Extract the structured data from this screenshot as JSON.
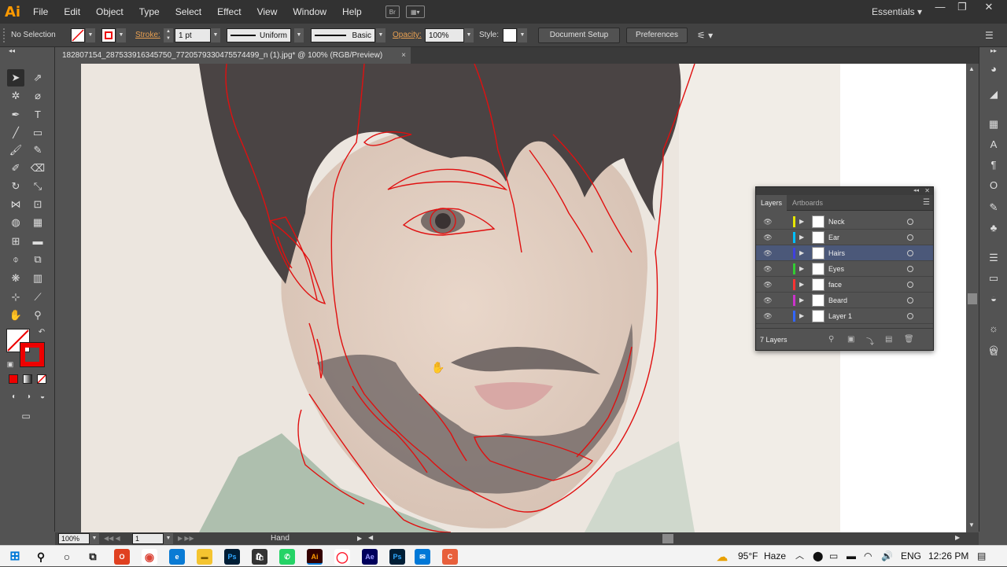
{
  "app": {
    "logo": "Ai"
  },
  "menu": [
    "File",
    "Edit",
    "Object",
    "Type",
    "Select",
    "Effect",
    "View",
    "Window",
    "Help"
  ],
  "menu_icons": {
    "bridge": "Br"
  },
  "workspace": "Essentials",
  "window_controls": {
    "minimize": "—",
    "restore": "❐",
    "close": "✕"
  },
  "control_bar": {
    "selection": "No Selection",
    "stroke_label": "Stroke:",
    "stroke_weight": "1 pt",
    "profile": "Uniform",
    "brush": "Basic",
    "opacity_label": "Opacity:",
    "opacity": "100%",
    "style_label": "Style:",
    "document_setup": "Document Setup",
    "preferences": "Preferences"
  },
  "document_tab": {
    "title": "182807154_287533916345750_7720579330475574499_n (1).jpg* @ 100% (RGB/Preview)",
    "close": "×"
  },
  "layers_panel": {
    "tabs": [
      "Layers",
      "Artboards"
    ],
    "layers": [
      {
        "name": "Neck",
        "color": "#e6e600"
      },
      {
        "name": "Ear",
        "color": "#00bfff"
      },
      {
        "name": "Hairs",
        "color": "#4040e0"
      },
      {
        "name": "Eyes",
        "color": "#33cc33"
      },
      {
        "name": "face",
        "color": "#ff3333"
      },
      {
        "name": "Beard",
        "color": "#cc33cc"
      },
      {
        "name": "Layer 1",
        "color": "#3366ff"
      }
    ],
    "selected_layer": "Hairs",
    "count_label": "7 Layers"
  },
  "status_bar": {
    "zoom": "100%",
    "artboard": "1",
    "tool": "Hand"
  },
  "taskbar": {
    "weather_temp": "95°F",
    "weather_text": "Haze",
    "language": "ENG",
    "time": "12:26 PM",
    "apps": [
      "Ps",
      "Ai",
      "Ae",
      "Ps"
    ]
  },
  "colors": {
    "outline": "#e01010",
    "accent": "#ff9a00",
    "selected_layer_bg": "#4b5879"
  }
}
